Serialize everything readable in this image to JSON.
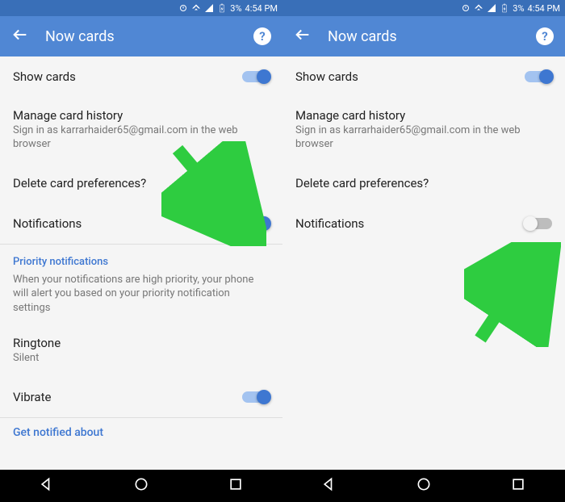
{
  "status": {
    "battery": "3%",
    "time": "4:54 PM"
  },
  "header": {
    "title": "Now cards"
  },
  "common": {
    "show_cards": "Show cards",
    "manage_history": "Manage card history",
    "manage_history_sub": "Sign in as karrarhaider65@gmail.com in the web browser",
    "delete_prefs": "Delete card preferences?",
    "notifications": "Notifications"
  },
  "left": {
    "priority_header": "Priority notifications",
    "priority_desc": "When your notifications are high priority, your phone will alert you based on your priority notification settings",
    "ringtone": "Ringtone",
    "ringtone_value": "Silent",
    "vibrate": "Vibrate",
    "get_notified": "Get notified about"
  }
}
